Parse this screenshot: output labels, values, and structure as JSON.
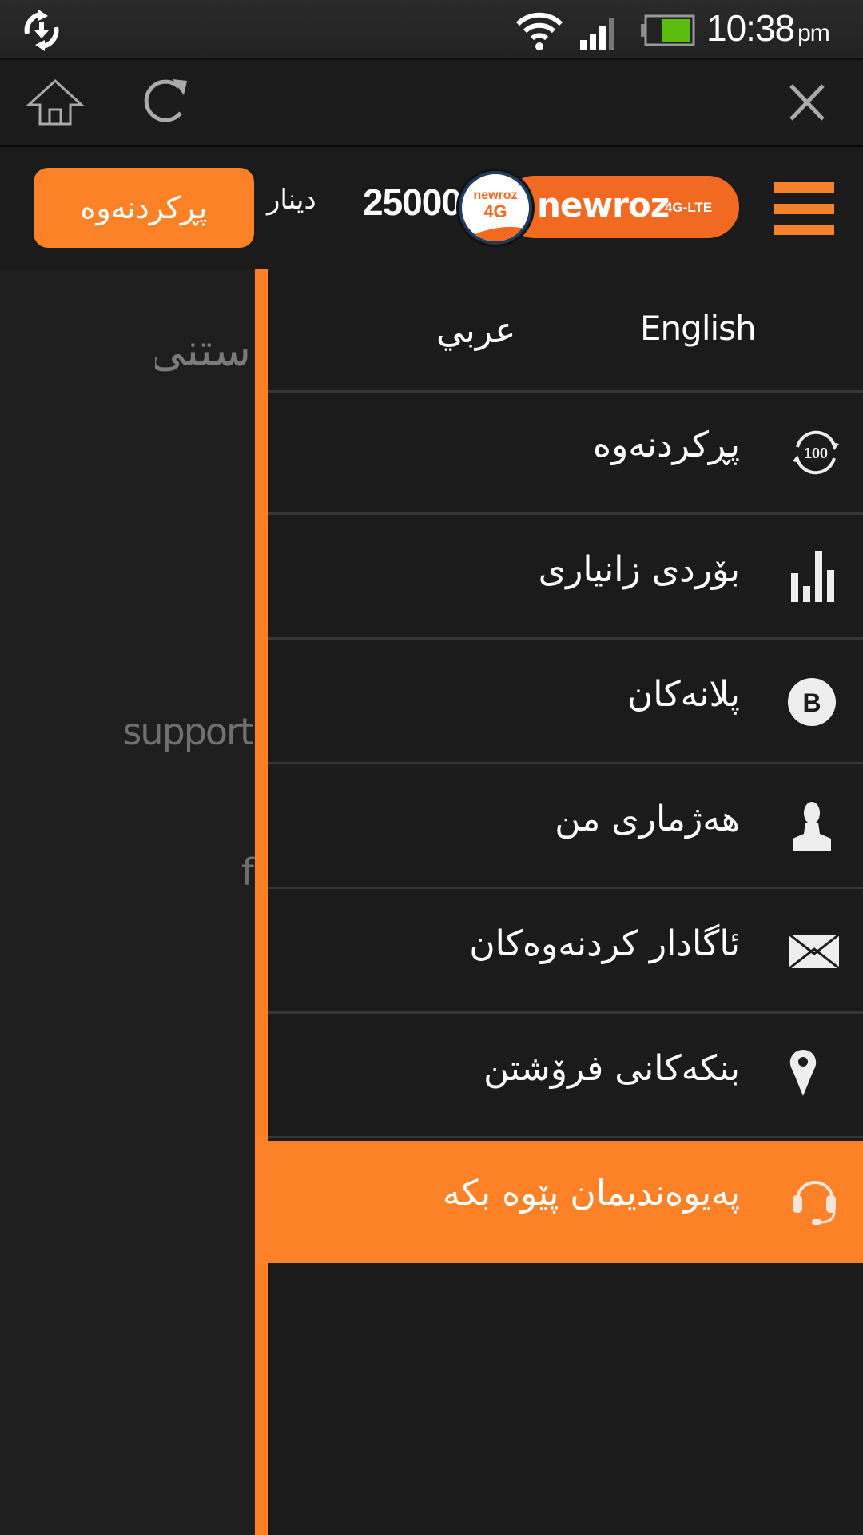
{
  "status_bar": {
    "time": "10:38",
    "ampm": "pm",
    "icons": [
      "sync-icon",
      "wifi-icon",
      "signal-icon",
      "battery-icon"
    ]
  },
  "browser_toolbar": {
    "icons": [
      "home-icon",
      "reload-icon",
      "close-icon"
    ]
  },
  "header": {
    "recharge_button": "پڕکردنەوە",
    "currency": "دینار",
    "balance": "25000",
    "logo": {
      "brand": "newroz",
      "suffix": "4G-LTE",
      "badge_top": "newroz",
      "badge_bottom": "4G"
    },
    "menu_icon": "hamburger-icon"
  },
  "background_page": {
    "text_1": "ستنی",
    "text_2": "support",
    "text_3": "f"
  },
  "drawer": {
    "languages": {
      "english": "English",
      "arabic": "عربي"
    },
    "items": [
      {
        "label": "پڕکردنەوە",
        "icon": "recharge-100-icon",
        "active": false
      },
      {
        "label": "بۆردی زانیاری",
        "icon": "bar-chart-icon",
        "active": false
      },
      {
        "label": "پلانەکان",
        "icon": "plans-b-icon",
        "active": false
      },
      {
        "label": "هەژماری من",
        "icon": "user-icon",
        "active": false
      },
      {
        "label": "ئاگادار کردنەوەکان",
        "icon": "envelope-icon",
        "active": false
      },
      {
        "label": "بنکەکانی فرۆشتن",
        "icon": "map-pin-icon",
        "active": false
      },
      {
        "label": "پەیوەندیمان پێوە بکە",
        "icon": "headset-icon",
        "active": true
      }
    ]
  },
  "colors": {
    "accent": "#fd8127",
    "logo_orange": "#f26a21",
    "background": "#1b1b1b",
    "divider": "#363636"
  }
}
